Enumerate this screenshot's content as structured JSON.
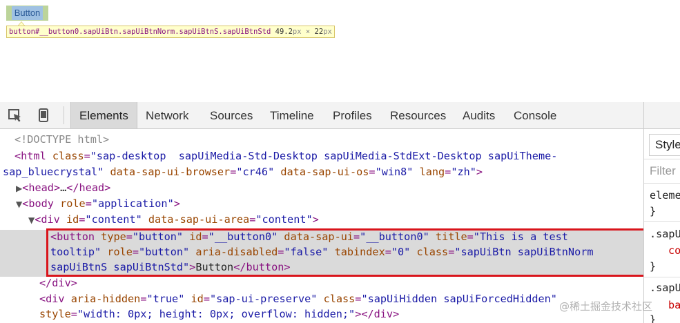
{
  "inspected_page": {
    "button_label": "Button",
    "tooltip_selector": "button#__button0.sapUiBtn.sapUiBtnNorm.sapUiBtnS.sapUiBtnStd",
    "tooltip_width": "49.2",
    "tooltip_unit_w": "px",
    "tooltip_times": " × ",
    "tooltip_height": "22",
    "tooltip_unit_h": "px"
  },
  "toolbar": {
    "icons": [
      "inspect-element-icon",
      "device-mode-icon"
    ],
    "tabs": [
      "Elements",
      "Network",
      "Sources",
      "Timeline",
      "Profiles",
      "Resources",
      "Audits",
      "Console"
    ],
    "active_tab": "Elements"
  },
  "dom": {
    "doctype": "<!DOCTYPE html>",
    "html_open_tag": "<html",
    "html_class_attr": "class",
    "html_class_val_a": "\"sap-desktop  sapUiMedia-Std-Desktop sapUiMedia-StdExt-Desktop sapUiTheme-",
    "html_class_val_b": "sap_bluecrystal\"",
    "html_browser_attr": "data-sap-ui-browser",
    "html_browser_val": "\"cr46\"",
    "html_os_attr": "data-sap-ui-os",
    "html_os_val": "\"win8\"",
    "html_lang_attr": "lang",
    "html_lang_val": "\"zh\"",
    "head_collapsed_open": "<head>",
    "head_ellipsis": "…",
    "head_close": "</head>",
    "body_open": "<body",
    "body_role_attr": "role",
    "body_role_val": "\"application\"",
    "div_open": "<div",
    "div_id_attr": "id",
    "div_id_val": "\"content\"",
    "div_area_attr": "data-sap-ui-area",
    "div_area_val": "\"content\"",
    "btn_open": "<button",
    "btn_type_attr": "type",
    "btn_type_val": "\"button\"",
    "btn_id_attr": "id",
    "btn_id_val": "\"__button0\"",
    "btn_dsu_attr": "data-sap-ui",
    "btn_dsu_val": "\"__button0\"",
    "btn_title_attr": "title",
    "btn_title_val_a": "\"This is a test",
    "btn_title_val_b": "tooltip\"",
    "btn_role_attr": "role",
    "btn_role_val": "\"button\"",
    "btn_aria_attr": "aria-disabled",
    "btn_aria_val": "\"false\"",
    "btn_tab_attr": "tabindex",
    "btn_tab_val": "\"0\"",
    "btn_class_attr": "class",
    "btn_class_val_a": "\"sapUiBtn sapUiBtnNorm",
    "btn_class_val_b": "sapUiBtnS sapUiBtnStd\"",
    "btn_text": "Button",
    "btn_close": "</button>",
    "div_close": "</div>",
    "div2_open": "<div",
    "div2_aria_attr": "aria-hidden",
    "div2_aria_val": "\"true\"",
    "div2_id_attr": "id",
    "div2_id_val": "\"sap-ui-preserve\"",
    "div2_class_attr": "class",
    "div2_class_val": "\"sapUiHidden sapUiForcedHidden\"",
    "div2_style_attr": "style",
    "div2_style_val": "\"width: 0px; height: 0px; overflow: hidden;\"",
    "div2_end": "></div>"
  },
  "styles_pane": {
    "tab_label": "Style",
    "filter_placeholder": "Filter",
    "rule1": "eleme",
    "brace1": "}",
    "rule2": ".sapU",
    "prop2": "co",
    "brace2": "}",
    "rule3": ".sapU",
    "prop3": "ba",
    "brace3": "}"
  },
  "watermark": "@稀土掘金技术社区",
  "colors": {
    "tag": "#881280",
    "attr": "#994500",
    "value": "#1a1aa6",
    "selection_border": "#d9141b",
    "selection_bg": "#dadada"
  }
}
